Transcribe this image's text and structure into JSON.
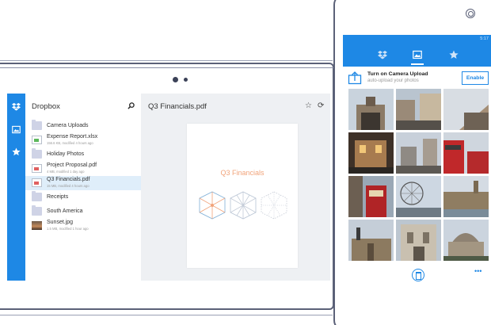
{
  "tablet": {
    "list_title": "Dropbox",
    "preview_title": "Q3 Financials.pdf",
    "document_heading": "Q3 Financials",
    "files": [
      {
        "name": "Camera Uploads",
        "meta": "",
        "kind": "folder-camera"
      },
      {
        "name": "Expense Report.xlsx",
        "meta": "156.6 KB, modified 4 hours ago",
        "kind": "spreadsheet"
      },
      {
        "name": "Holiday Photos",
        "meta": "",
        "kind": "folder"
      },
      {
        "name": "Project Proposal.pdf",
        "meta": "4 MB, modified 1 day ago",
        "kind": "pdf"
      },
      {
        "name": "Q3 Financials.pdf",
        "meta": "15 MB, modified 4 hours ago",
        "kind": "pdf",
        "selected": true
      },
      {
        "name": "Receipts",
        "meta": "",
        "kind": "folder"
      },
      {
        "name": "South America",
        "meta": "",
        "kind": "folder-shared"
      },
      {
        "name": "Sunset.jpg",
        "meta": "1.5 MB, modified 1 hour ago",
        "kind": "image"
      }
    ],
    "rail_icons": [
      "dropbox-icon",
      "photos-icon",
      "star-icon"
    ]
  },
  "phone": {
    "time": "5:17",
    "nav_icons": [
      "dropbox-icon",
      "photos-icon",
      "star-icon"
    ],
    "banner_title": "Turn on Camera Upload",
    "banner_subtitle": "auto-upload your photos",
    "enable_label": "Enable",
    "more_label": "•••",
    "photo_count": 12
  },
  "colors": {
    "accent": "#1e88e5",
    "selected_row": "#dfeefa",
    "preview_bg": "#eef0f3",
    "doc_heading": "#f1a37a"
  }
}
